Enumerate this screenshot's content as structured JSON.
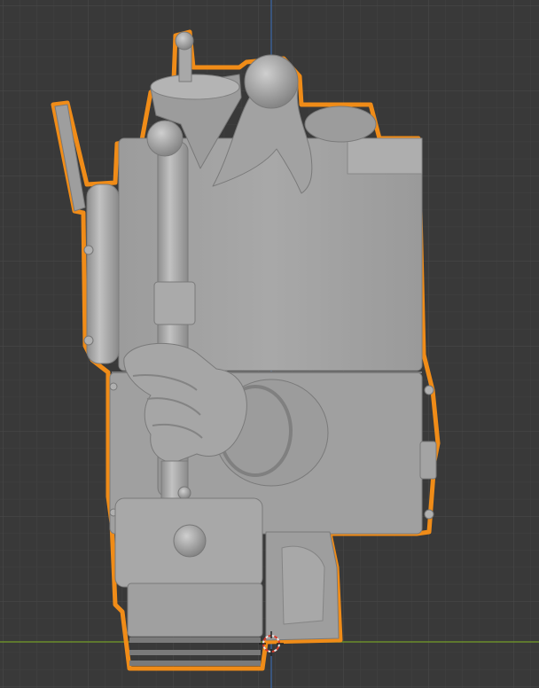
{
  "viewport": {
    "background": "#393939",
    "grid_minor_color": "#3f3f3f",
    "grid_major_color": "#464646",
    "x_axis_color": "#6b8e2b",
    "y_axis_color": "#3b5f93",
    "selection_outline_color": "#f08c18",
    "model_fill_color": "#a6a6a6",
    "model_shadow_color": "#8a8a8a",
    "model_highlight_color": "#bdbdbd"
  },
  "object": {
    "name": "",
    "selected": true,
    "description_icon": "mesh-object"
  },
  "cursor": {
    "icon": "3d-cursor-icon"
  }
}
